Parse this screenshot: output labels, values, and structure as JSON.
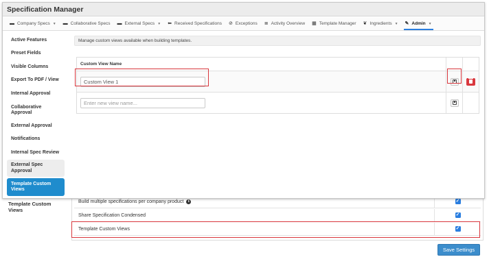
{
  "modal": {
    "title": "Specification Manager"
  },
  "nav": [
    {
      "label": "Company Specs",
      "icon": "building-icon",
      "glyph": "▬",
      "caret": "▼"
    },
    {
      "label": "Collaborative Specs",
      "icon": "building-icon",
      "glyph": "▬",
      "caret": ""
    },
    {
      "label": "External Specs",
      "icon": "building-icon",
      "glyph": "▬",
      "caret": "▼"
    },
    {
      "label": "Received Specifications",
      "icon": "arrow-left-icon",
      "glyph": "⬅",
      "caret": ""
    },
    {
      "label": "Exceptions",
      "icon": "check-circle-icon",
      "glyph": "⊘",
      "caret": ""
    },
    {
      "label": "Activity Overview",
      "icon": "list-icon",
      "glyph": "≣",
      "caret": ""
    },
    {
      "label": "Template Manager",
      "icon": "table-icon",
      "glyph": "▦",
      "caret": ""
    },
    {
      "label": "Ingredients",
      "icon": "leaf-icon",
      "glyph": "❦",
      "caret": "▼"
    },
    {
      "label": "Admin",
      "icon": "wrench-icon",
      "glyph": "✎",
      "caret": "▼",
      "active": true
    }
  ],
  "sidebar": {
    "items": [
      {
        "label": "Active Features"
      },
      {
        "label": "Preset Fields"
      },
      {
        "label": "Visible Columns"
      },
      {
        "label": "Export To PDF / View"
      },
      {
        "label": "Internal Approval"
      },
      {
        "label": "Collaborative Approval"
      },
      {
        "label": "External Approval"
      },
      {
        "label": "Notifications"
      },
      {
        "label": "Internal Spec Review"
      },
      {
        "label": "External Spec Approval"
      },
      {
        "label": "Template Custom Views"
      }
    ]
  },
  "content": {
    "description": "Manage custom views available when building templates.",
    "table_header": "Custom View Name",
    "rows": [
      {
        "value": "Custom View 1"
      }
    ],
    "new_row_placeholder": "Enter new view name..."
  },
  "background": {
    "sidebar_item": "Template Custom Views",
    "settings": [
      {
        "label": "Build multiple specifications per company product",
        "checked": true,
        "info": true
      },
      {
        "label": "Share Specification Condensed",
        "checked": true
      },
      {
        "label": "Template Custom Views",
        "checked": true
      }
    ],
    "save_label": "Save Settings"
  },
  "colors": {
    "accent": "#1f8ccd",
    "highlight": "#d8353b",
    "delete": "#d9383e",
    "checkbox": "#2a7ee0"
  }
}
